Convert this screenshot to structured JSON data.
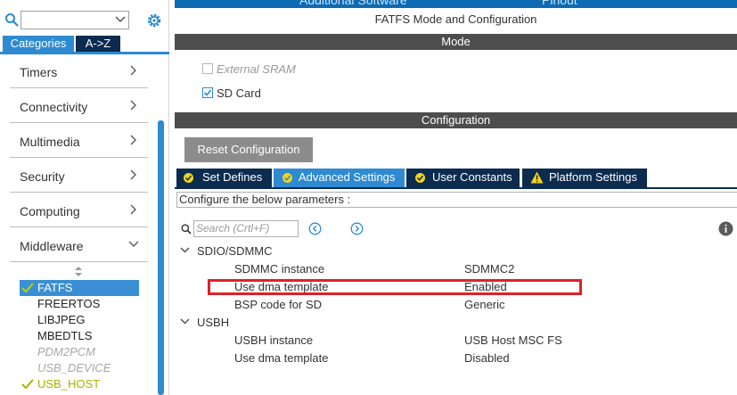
{
  "top_banner": {
    "left_text": "Additional Software",
    "right_text": "Pinout"
  },
  "left_panel": {
    "search": {
      "value": ""
    },
    "tabs": [
      {
        "label": "Categories",
        "active": true
      },
      {
        "label": "A->Z",
        "active": false
      }
    ],
    "categories": [
      {
        "label": "Timers",
        "expanded": false
      },
      {
        "label": "Connectivity",
        "expanded": false
      },
      {
        "label": "Multimedia",
        "expanded": false
      },
      {
        "label": "Security",
        "expanded": false
      },
      {
        "label": "Computing",
        "expanded": false
      },
      {
        "label": "Middleware",
        "expanded": true
      }
    ],
    "middleware_items": [
      {
        "label": "FATFS",
        "state": "selected",
        "checked": true
      },
      {
        "label": "FREERTOS",
        "state": "normal",
        "checked": false
      },
      {
        "label": "LIBJPEG",
        "state": "normal",
        "checked": false
      },
      {
        "label": "MBEDTLS",
        "state": "normal",
        "checked": false
      },
      {
        "label": "PDM2PCM",
        "state": "disabled",
        "checked": false
      },
      {
        "label": "USB_DEVICE",
        "state": "disabled",
        "checked": false
      },
      {
        "label": "USB_HOST",
        "state": "enabled",
        "checked": true
      }
    ]
  },
  "right_panel": {
    "title": "FATFS Mode and Configuration",
    "mode_header": "Mode",
    "mode_options": [
      {
        "label": "External SRAM",
        "checked": false,
        "disabled": true
      },
      {
        "label": "SD Card",
        "checked": true,
        "disabled": false
      }
    ],
    "config_header": "Configuration",
    "reset_button": "Reset Configuration",
    "tabs": [
      {
        "label": "Set Defines",
        "icon": "check-circle-icon",
        "active": false
      },
      {
        "label": "Advanced Settings",
        "icon": "check-circle-icon",
        "active": true
      },
      {
        "label": "User Constants",
        "icon": "check-circle-icon",
        "active": false
      },
      {
        "label": "Platform Settings",
        "icon": "warning-icon",
        "active": false
      }
    ],
    "configure_label": "Configure the below parameters :",
    "search_placeholder": "Search (Crtl+F)",
    "groups": [
      {
        "name": "SDIO/SDMMC",
        "params": [
          {
            "name": "SDMMC instance",
            "value": "SDMMC2"
          },
          {
            "name": "Use dma template",
            "value": "Enabled"
          },
          {
            "name": "BSP code for SD",
            "value": "Generic"
          }
        ]
      },
      {
        "name": "USBH",
        "params": [
          {
            "name": "USBH instance",
            "value": "USB Host MSC FS"
          },
          {
            "name": "Use dma template",
            "value": "Disabled"
          }
        ]
      }
    ]
  },
  "colors": {
    "accent_blue": "#2e8ad1",
    "dark_navy": "#0b2b4f",
    "section_gray": "#4d4d4d",
    "highlight_red": "#e0202a",
    "enabled_green": "#a8b400"
  }
}
